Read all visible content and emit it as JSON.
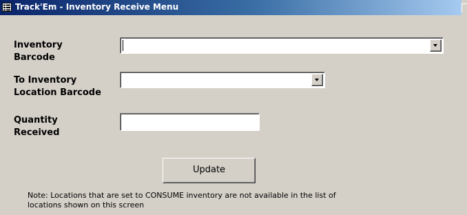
{
  "window": {
    "title": "Track'Em - Inventory Receive Menu",
    "title_icon": "form-icon"
  },
  "form": {
    "inventory_barcode": {
      "label_line1": "Inventory",
      "label_line2": "Barcode",
      "value": ""
    },
    "location_barcode": {
      "label_line1": "To Inventory",
      "label_line2": "Location Barcode",
      "value": ""
    },
    "quantity_received": {
      "label_line1": "Quantity",
      "label_line2": "Received",
      "value": ""
    },
    "update_label": "Update",
    "note_line1": "Note: Locations that are set to CONSUME inventory are not available in the list of",
    "note_line2": "locations shown on this screen"
  },
  "colors": {
    "window_bg": "#d4d0c8",
    "titlebar_start": "#0a246a",
    "titlebar_end": "#a6caf0",
    "field_bg": "#ffffff"
  }
}
